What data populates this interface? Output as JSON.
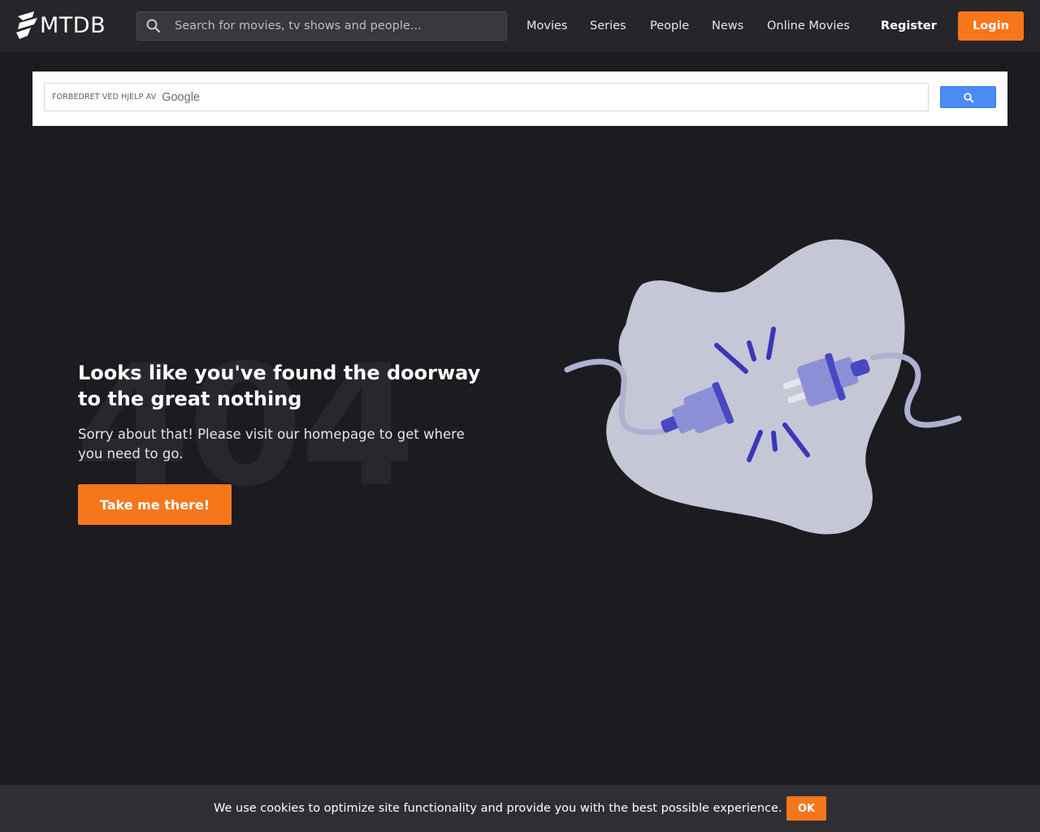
{
  "header": {
    "logo_text": "MTDB",
    "search": {
      "placeholder": "Search for movies, tv shows and people..."
    },
    "nav": [
      {
        "label": "Movies"
      },
      {
        "label": "Series"
      },
      {
        "label": "People"
      },
      {
        "label": "News"
      },
      {
        "label": "Online Movies"
      }
    ],
    "register_label": "Register",
    "login_label": "Login"
  },
  "google_search": {
    "powered_by": "FORBEDRET VED HJELP AV",
    "brand": "Google"
  },
  "error_page": {
    "code": "404",
    "heading": "Looks like you've found the doorway to the great nothing",
    "subtext": "Sorry about that! Please visit our homepage to get where you need to go.",
    "cta_label": "Take me there!"
  },
  "cookie_bar": {
    "text": "We use cookies to optimize site functionality and provide you with the best possible experience.",
    "ok_label": "OK"
  },
  "colors": {
    "accent": "#f7761c",
    "background": "#1c1b20",
    "header": "#25252a",
    "google_button": "#4c8bf5"
  }
}
